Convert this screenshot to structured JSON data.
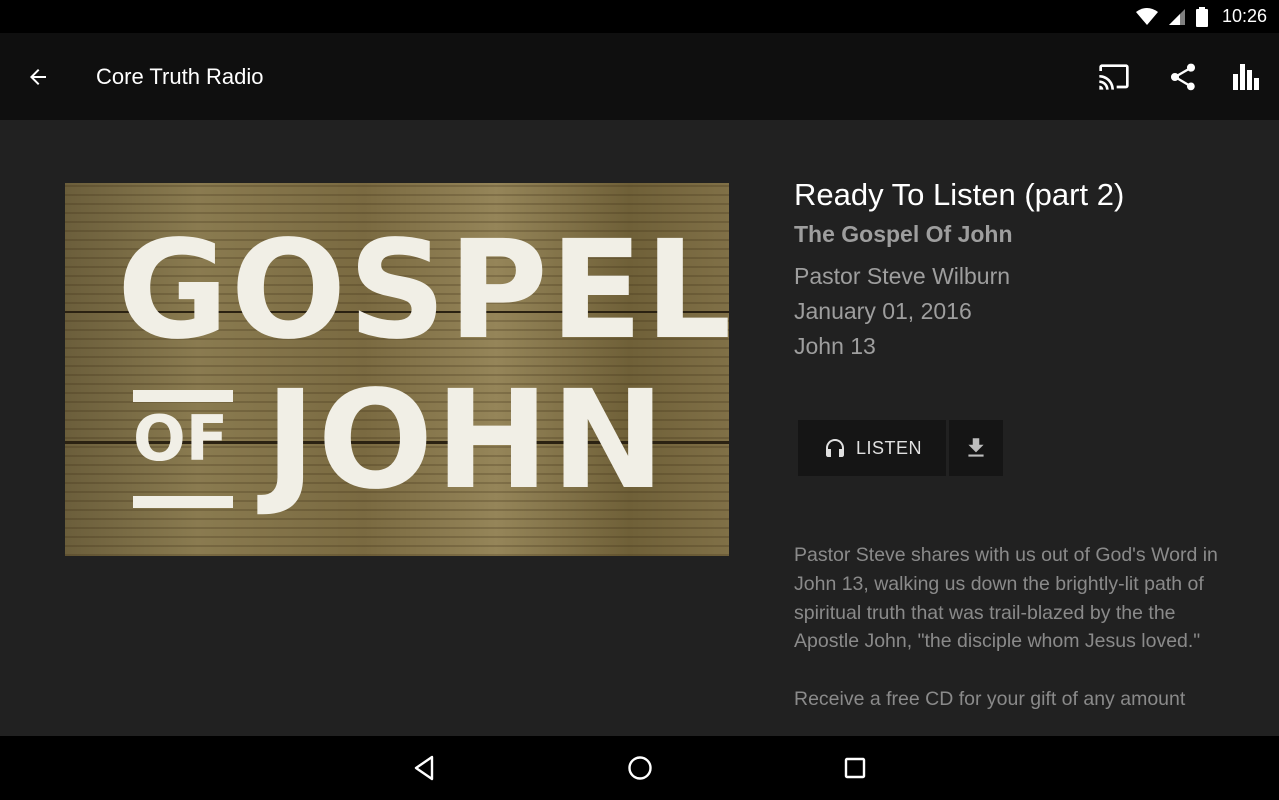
{
  "status_bar": {
    "time": "10:26"
  },
  "app_bar": {
    "title": "Core Truth Radio"
  },
  "artwork": {
    "line1": "GOSPEL",
    "line2_small": "OF",
    "line3": "JOHN"
  },
  "episode": {
    "title": "Ready To Listen (part 2)",
    "series": "The Gospel Of John",
    "speaker": "Pastor Steve Wilburn",
    "date": "January 01, 2016",
    "scripture": "John 13"
  },
  "actions": {
    "listen_label": "LISTEN"
  },
  "description": {
    "paragraph1": "Pastor Steve shares with us out of God's Word in John 13, walking us down the brightly-lit path of spiritual truth that was trail-blazed by the the Apostle John, \"the disciple whom Jesus loved.\"",
    "paragraph2": "Receive a free CD for your gift of any amount"
  },
  "colors": {
    "background": "#212121",
    "app_bar": "#0f0f0f",
    "secondary_text": "#9e9e9e",
    "description_text": "#8a8a8a"
  }
}
